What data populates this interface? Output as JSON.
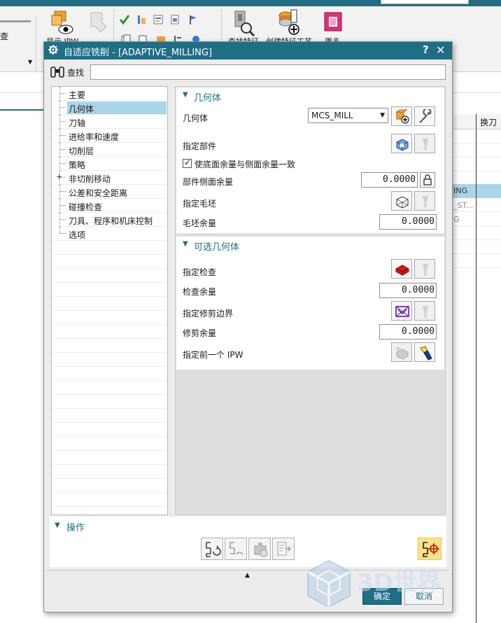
{
  "background": {
    "left_panel_text": "查",
    "ribbon": [
      {
        "label": "显示 IPW"
      },
      {
        "label": "创建特征工艺"
      },
      {
        "label": "查找特征"
      },
      {
        "label": "更多"
      }
    ],
    "grid_header": "换刀",
    "grid_cells": [
      "ING",
      "_ST...",
      "G"
    ]
  },
  "dialog": {
    "title": "自适应铣削 - [ADAPTIVE_MILLING]",
    "help": "?",
    "close": "✕",
    "find_label": "查找",
    "find_value": "",
    "tree": [
      {
        "label": "主要",
        "selected": false,
        "expandable": false
      },
      {
        "label": "几何体",
        "selected": true,
        "expandable": false
      },
      {
        "label": "刀轴",
        "selected": false,
        "expandable": false
      },
      {
        "label": "进给率和速度",
        "selected": false,
        "expandable": false
      },
      {
        "label": "切削层",
        "selected": false,
        "expandable": false
      },
      {
        "label": "策略",
        "selected": false,
        "expandable": false
      },
      {
        "label": "非切削移动",
        "selected": false,
        "expandable": true
      },
      {
        "label": "公差和安全距离",
        "selected": false,
        "expandable": false
      },
      {
        "label": "碰撞检查",
        "selected": false,
        "expandable": false
      },
      {
        "label": "刀具、程序和机床控制",
        "selected": false,
        "expandable": false
      },
      {
        "label": "选项",
        "selected": false,
        "expandable": false
      }
    ],
    "geometry": {
      "title": "几何体",
      "geometry_label": "几何体",
      "geometry_value": "MCS_MILL",
      "specify_part": "指定部件",
      "floor_same_as_side": "使底面余量与侧面余量一致",
      "floor_same_checked": true,
      "part_side_stock_label": "部件侧面余量",
      "part_side_stock_value": "0.0000",
      "specify_blank": "指定毛坯",
      "blank_stock_label": "毛坯余量",
      "blank_stock_value": "0.0000"
    },
    "optional_geometry": {
      "title": "可选几何体",
      "specify_check": "指定检查",
      "check_stock_label": "检查余量",
      "check_stock_value": "0.0000",
      "specify_trim": "指定修剪边界",
      "trim_stock_label": "修剪余量",
      "trim_stock_value": "0.0000",
      "specify_prev_ipw": "指定前一个 IPW"
    },
    "operations": {
      "title": "操作"
    },
    "ok_label": "确定",
    "cancel_label": "取消"
  },
  "watermark": "3D世界"
}
